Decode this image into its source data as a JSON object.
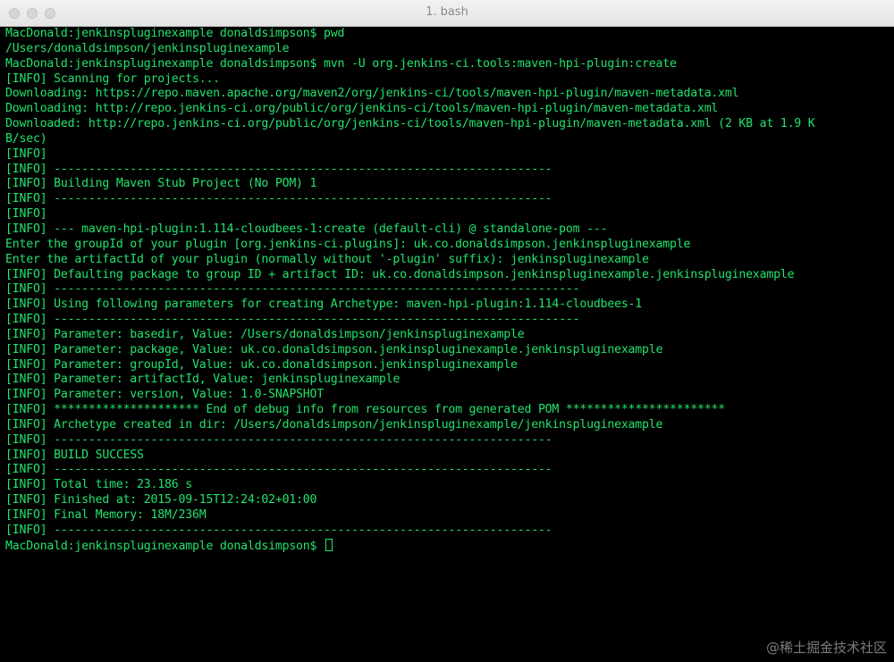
{
  "window": {
    "title": "1. bash"
  },
  "terminal": {
    "lines": [
      "MacDonald:jenkinspluginexample donaldsimpson$ pwd",
      "/Users/donaldsimpson/jenkinspluginexample",
      "MacDonald:jenkinspluginexample donaldsimpson$ mvn -U org.jenkins-ci.tools:maven-hpi-plugin:create",
      "[INFO] Scanning for projects...",
      "Downloading: https://repo.maven.apache.org/maven2/org/jenkins-ci/tools/maven-hpi-plugin/maven-metadata.xml",
      "Downloading: http://repo.jenkins-ci.org/public/org/jenkins-ci/tools/maven-hpi-plugin/maven-metadata.xml",
      "Downloaded: http://repo.jenkins-ci.org/public/org/jenkins-ci/tools/maven-hpi-plugin/maven-metadata.xml (2 KB at 1.9 K",
      "B/sec)",
      "[INFO]",
      "[INFO] ------------------------------------------------------------------------",
      "[INFO] Building Maven Stub Project (No POM) 1",
      "[INFO] ------------------------------------------------------------------------",
      "[INFO]",
      "[INFO] --- maven-hpi-plugin:1.114-cloudbees-1:create (default-cli) @ standalone-pom ---",
      "Enter the groupId of your plugin [org.jenkins-ci.plugins]: uk.co.donaldsimpson.jenkinspluginexample",
      "Enter the artifactId of your plugin (normally without '-plugin' suffix): jenkinspluginexample",
      "[INFO] Defaulting package to group ID + artifact ID: uk.co.donaldsimpson.jenkinspluginexample.jenkinspluginexample",
      "[INFO] ----------------------------------------------------------------------------",
      "[INFO] Using following parameters for creating Archetype: maven-hpi-plugin:1.114-cloudbees-1",
      "[INFO] ----------------------------------------------------------------------------",
      "[INFO] Parameter: basedir, Value: /Users/donaldsimpson/jenkinspluginexample",
      "[INFO] Parameter: package, Value: uk.co.donaldsimpson.jenkinspluginexample.jenkinspluginexample",
      "[INFO] Parameter: groupId, Value: uk.co.donaldsimpson.jenkinspluginexample",
      "[INFO] Parameter: artifactId, Value: jenkinspluginexample",
      "[INFO] Parameter: version, Value: 1.0-SNAPSHOT",
      "[INFO] ********************* End of debug info from resources from generated POM ***********************",
      "[INFO] Archetype created in dir: /Users/donaldsimpson/jenkinspluginexample/jenkinspluginexample",
      "[INFO] ------------------------------------------------------------------------",
      "[INFO] BUILD SUCCESS",
      "[INFO] ------------------------------------------------------------------------",
      "[INFO] Total time: 23.186 s",
      "[INFO] Finished at: 2015-09-15T12:24:02+01:00",
      "[INFO] Final Memory: 18M/236M",
      "[INFO] ------------------------------------------------------------------------"
    ],
    "prompt": "MacDonald:jenkinspluginexample donaldsimpson$ "
  },
  "watermark": "@稀土掘金技术社区",
  "colors": {
    "background": "#000000",
    "text": "#22e36c"
  }
}
